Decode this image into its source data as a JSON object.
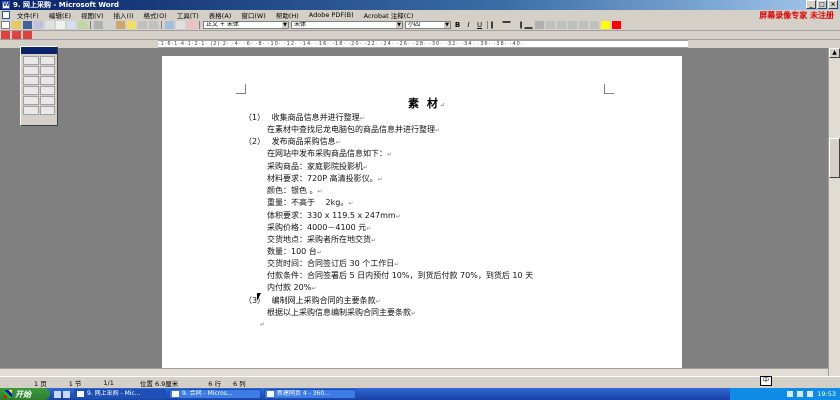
{
  "window": {
    "title": "9. 网上采购 - Microsoft Word",
    "buttons": [
      "_",
      "□",
      "×"
    ]
  },
  "menubar": {
    "items": [
      "文件(F)",
      "编辑(E)",
      "视图(V)",
      "插入(I)",
      "格式(O)",
      "工具(T)",
      "表格(A)",
      "窗口(W)",
      "帮助(H)",
      "Adobe PDF(B)",
      "Acrobat 注释(C)"
    ],
    "overlay": "屏幕录像专家 未注册"
  },
  "formatting": {
    "style": "正文 + 宋体",
    "font": "宋体",
    "size": "小四",
    "bold": "B",
    "italic": "I",
    "underline": "U"
  },
  "ruler": {
    "labels": "·1·6·1·4·1·2·1· |2|·2· ·4· ·6· ·8· ·10· ·12· ·14· ·16· ·18· ·20· ·22· ·24· ·26· ·28· ·30· ·32· ·34· ·36· ·38· ·40·"
  },
  "document": {
    "title": "素 材",
    "lines": [
      "（1）　 收集商品信息并进行整理",
      "在素材中查找尼龙电脑包的商品信息并进行整理",
      "（2）　 发布商品采购信息",
      "在网站中发布采购商品信息如下：",
      "采购商品：家庭影院投影机",
      "材料要求：720P 高清投影仪。",
      "颜色：银色 。",
      "重量：不高于　 2kg。",
      "体积要求：330 x 119.5 x 247mm",
      "采购价格：4000－4100 元",
      "交货地点：采购者所在地交货",
      "数量：100 台",
      "交货时间：合同签订后 30 个工作日",
      "付款条件：合同签署后 5 日内预付 10%，到货后付款 70%，到货后 10 天",
      "内付款 20%",
      "（3）　 编制网上采购合同的主要条款",
      "根据以上采购信息编制采购合同主要条款"
    ],
    "para_mark": "↵"
  },
  "statusbar": {
    "page": "1 页",
    "section": "1 节",
    "page_of": "1/1",
    "position": "位置 6.9厘米",
    "line": "6 行",
    "column": "6 列"
  },
  "ime": "中",
  "taskbar": {
    "start": "开始",
    "tasks": [
      "9. 网上采购 - Mic...",
      "9. 合同 - Micros...",
      "新建网页 4 - 360..."
    ],
    "clock": "19:53"
  }
}
